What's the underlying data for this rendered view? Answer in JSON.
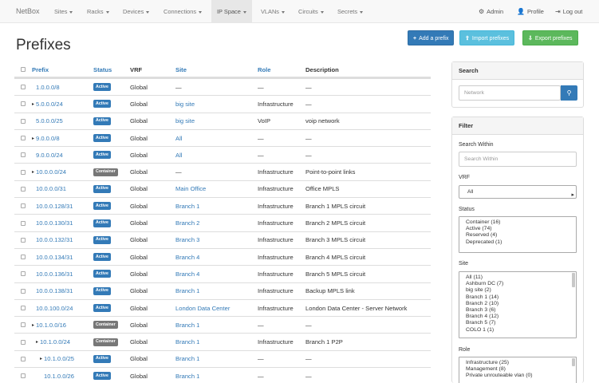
{
  "navbar": {
    "brand": "NetBox",
    "items": [
      {
        "label": "Sites"
      },
      {
        "label": "Racks"
      },
      {
        "label": "Devices"
      },
      {
        "label": "Connections"
      },
      {
        "label": "IP Space",
        "active": true
      },
      {
        "label": "VLANs"
      },
      {
        "label": "Circuits"
      },
      {
        "label": "Secrets"
      }
    ],
    "admin": "Admin",
    "profile": "Profile",
    "logout": "Log out"
  },
  "page": {
    "title": "Prefixes",
    "add_button": "Add a prefix",
    "import_button": "Import prefixes",
    "export_button": "Export prefixes"
  },
  "table": {
    "headers": {
      "prefix": "Prefix",
      "status": "Status",
      "vrf": "VRF",
      "site": "Site",
      "role": "Role",
      "description": "Description"
    },
    "rows": [
      {
        "prefix": "1.0.0.0/8",
        "status": "Active",
        "vrf": "Global",
        "site": "—",
        "role": "—",
        "description": "—"
      },
      {
        "prefix": "5.0.0.0/24",
        "status": "Active",
        "vrf": "Global",
        "site": "big site",
        "role": "Infrastructure",
        "description": "—"
      },
      {
        "prefix": "5.0.0.0/25",
        "status": "Active",
        "vrf": "Global",
        "site": "big site",
        "role": "VoIP",
        "description": "voip network"
      },
      {
        "prefix": "9.0.0.0/8",
        "status": "Active",
        "vrf": "Global",
        "site": "All",
        "role": "—",
        "description": "—"
      },
      {
        "prefix": "9.0.0.0/24",
        "status": "Active",
        "vrf": "Global",
        "site": "All",
        "role": "—",
        "description": "—"
      },
      {
        "prefix": "10.0.0.0/24",
        "status": "Container",
        "vrf": "Global",
        "site": "—",
        "role": "Infrastructure",
        "description": "Point-to-point links"
      },
      {
        "prefix": "10.0.0.0/31",
        "status": "Active",
        "vrf": "Global",
        "site": "Main Office",
        "role": "Infrastructure",
        "description": "Office MPLS"
      },
      {
        "prefix": "10.0.0.128/31",
        "status": "Active",
        "vrf": "Global",
        "site": "Branch 1",
        "role": "Infrastructure",
        "description": "Branch 1 MPLS circuit"
      },
      {
        "prefix": "10.0.0.130/31",
        "status": "Active",
        "vrf": "Global",
        "site": "Branch 2",
        "role": "Infrastructure",
        "description": "Branch 2 MPLS circuit"
      },
      {
        "prefix": "10.0.0.132/31",
        "status": "Active",
        "vrf": "Global",
        "site": "Branch 3",
        "role": "Infrastructure",
        "description": "Branch 3 MPLS circuit"
      },
      {
        "prefix": "10.0.0.134/31",
        "status": "Active",
        "vrf": "Global",
        "site": "Branch 4",
        "role": "Infrastructure",
        "description": "Branch 4 MPLS circuit"
      },
      {
        "prefix": "10.0.0.136/31",
        "status": "Active",
        "vrf": "Global",
        "site": "Branch 4",
        "role": "Infrastructure",
        "description": "Branch 5 MPLS circuit"
      },
      {
        "prefix": "10.0.0.138/31",
        "status": "Active",
        "vrf": "Global",
        "site": "Branch 1",
        "role": "Infrastructure",
        "description": "Backup MPLS link"
      },
      {
        "prefix": "10.0.100.0/24",
        "status": "Active",
        "vrf": "Global",
        "site": "London Data Center",
        "role": "Infrastructure",
        "description": "London Data Center - Server Network"
      },
      {
        "prefix": "10.1.0.0/16",
        "status": "Container",
        "vrf": "Global",
        "site": "Branch 1",
        "role": "—",
        "description": "—"
      },
      {
        "prefix": "10.1.0.0/24",
        "status": "Container",
        "vrf": "Global",
        "site": "Branch 1",
        "role": "Infrastructure",
        "description": "Branch 1 P2P"
      },
      {
        "prefix": "10.1.0.0/25",
        "status": "Active",
        "vrf": "Global",
        "site": "Branch 1",
        "role": "—",
        "description": "—"
      },
      {
        "prefix": "10.1.0.0/26",
        "status": "Active",
        "vrf": "Global",
        "site": "Branch 1",
        "role": "—",
        "description": "—"
      }
    ]
  },
  "search": {
    "heading": "Search",
    "placeholder": "Network"
  },
  "filter": {
    "heading": "Filter",
    "search_within_label": "Search Within",
    "search_within_placeholder": "Search Within",
    "vrf_label": "VRF",
    "vrf_selected": "All",
    "status_label": "Status",
    "status_options": [
      "Container (16)",
      "Active (74)",
      "Reserved (4)",
      "Deprecated (1)"
    ],
    "site_label": "Site",
    "site_options": [
      "All (11)",
      "Ashburn DC (7)",
      "big site (2)",
      "Branch 1 (14)",
      "Branch 2 (10)",
      "Branch 3 (6)",
      "Branch 4 (12)",
      "Branch 5 (7)",
      "COLO 1 (1)"
    ],
    "role_label": "Role",
    "role_options": [
      "Infrastructure (25)",
      "Management (8)",
      "Private unrouteable vlan (0)"
    ]
  },
  "colors": {
    "link": "#337ab7",
    "active_label": "#337ab7",
    "container_label": "#777777",
    "btn_primary": "#337ab7",
    "btn_info": "#5bc0de",
    "btn_success": "#5cb85c"
  }
}
